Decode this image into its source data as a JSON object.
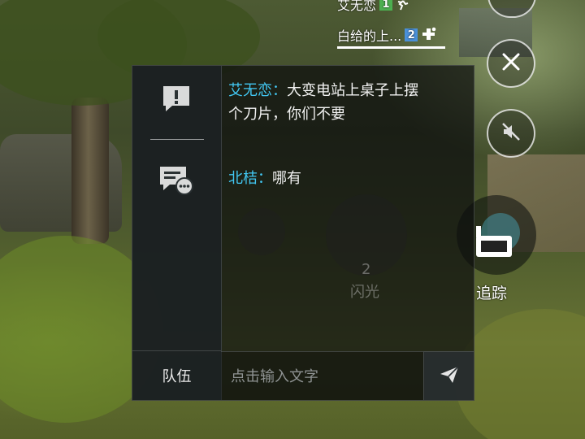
{
  "team_list": {
    "rows": [
      {
        "name": "艾无恋",
        "number": "1",
        "status_icon": "running-icon"
      },
      {
        "name": "白给的上...",
        "number": "2",
        "status_icon": "medic-cross-icon"
      }
    ]
  },
  "right_controls": {
    "track_label": "追踪"
  },
  "chat": {
    "messages": [
      {
        "sender": "艾无恋：",
        "line1": "大变电站上桌子上摆",
        "line2": "个刀片，你们不要"
      },
      {
        "sender": "北桔：",
        "text": "哪有"
      }
    ],
    "team_tab_label": "队伍",
    "input_placeholder": "点击输入文字"
  },
  "background_hud": {
    "ghost_count": "2",
    "ghost_label": "闪光"
  },
  "colors": {
    "sender_name": "#42c8f4",
    "badge_green": "#4caf50",
    "badge_blue": "#4a90d9"
  }
}
